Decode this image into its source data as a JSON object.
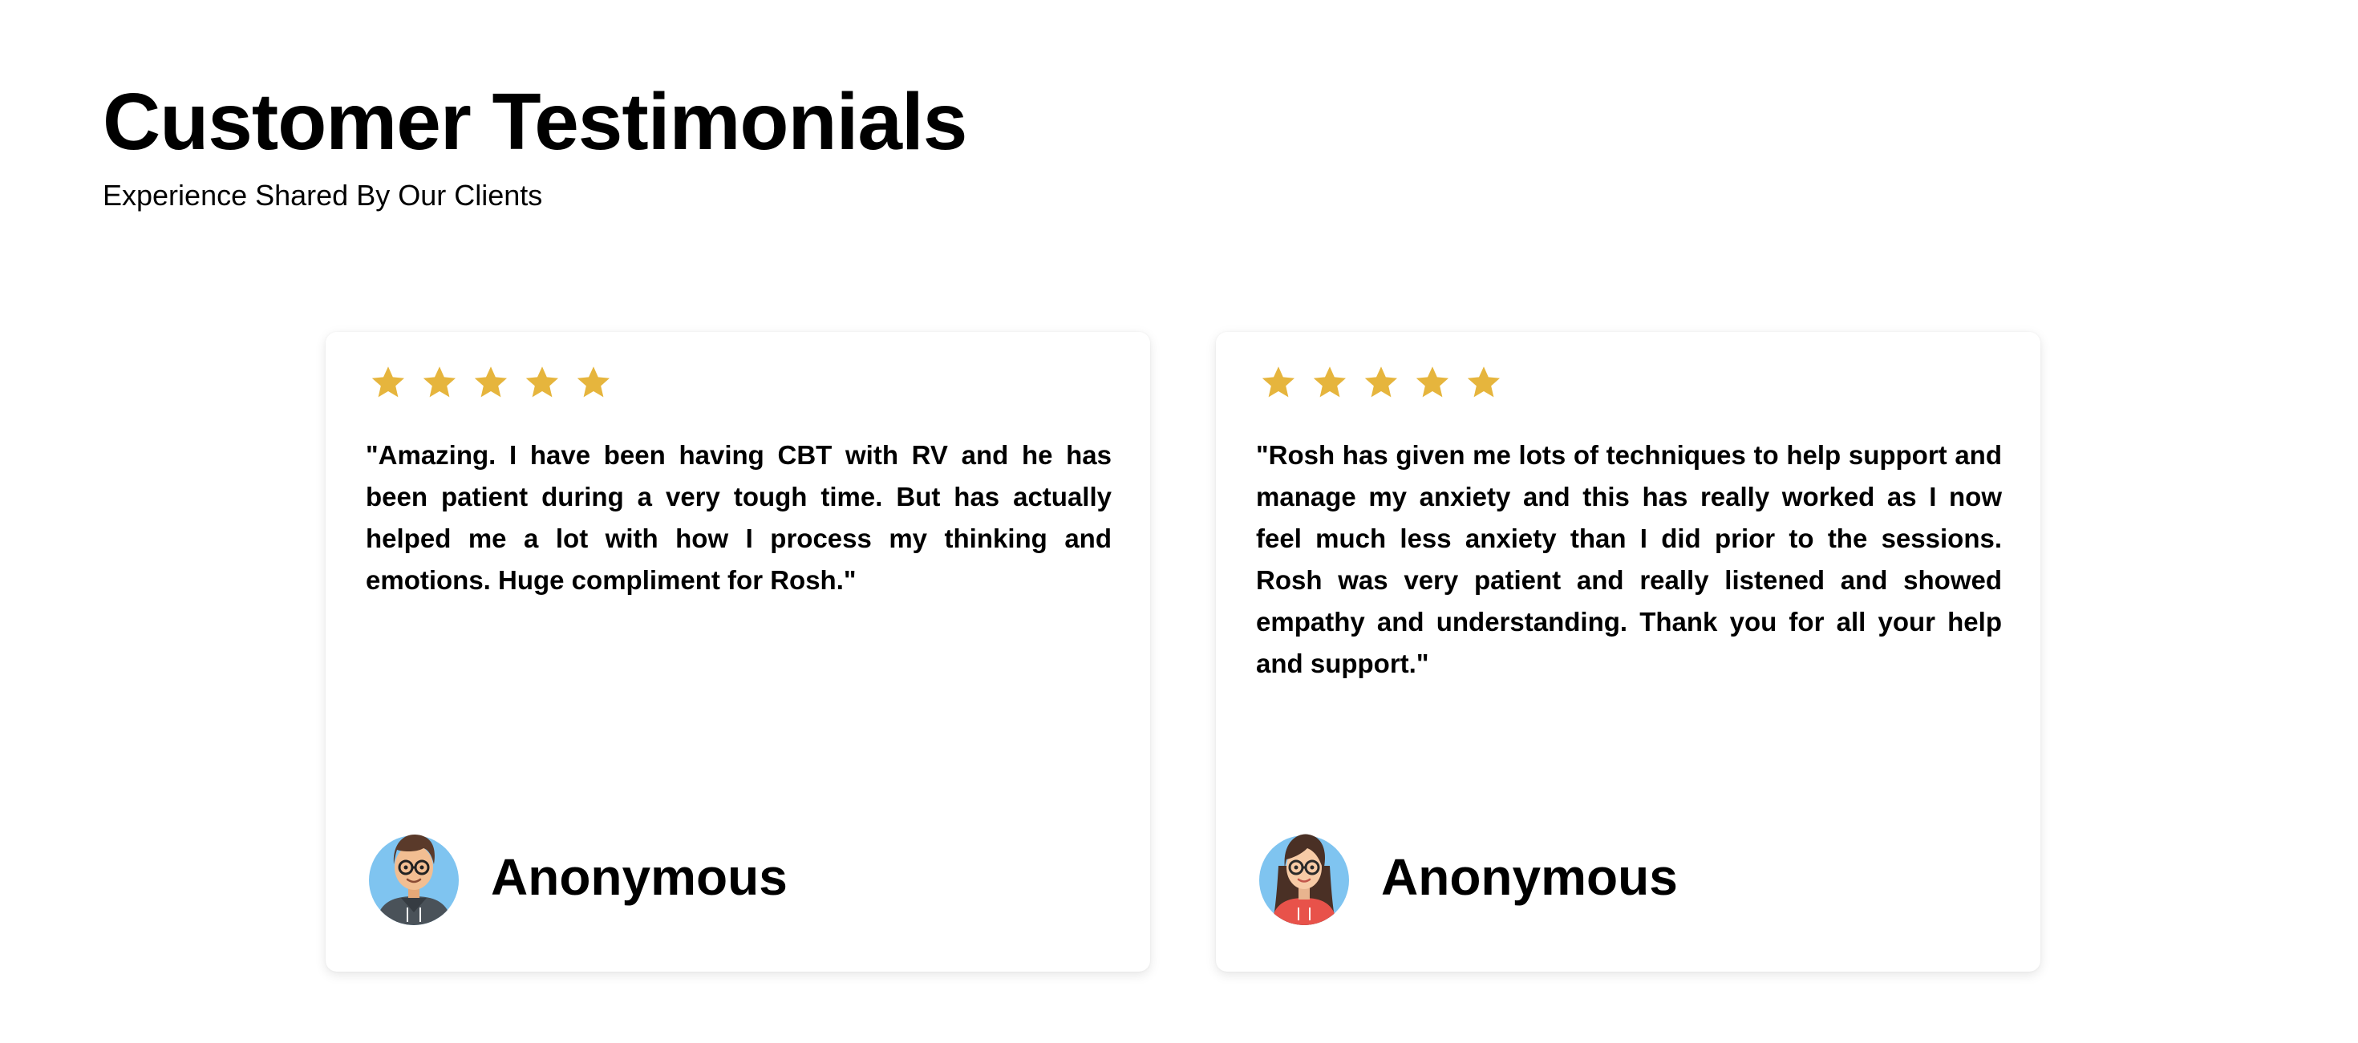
{
  "header": {
    "title": "Customer Testimonials",
    "subtitle": "Experience Shared By Our Clients"
  },
  "colors": {
    "star": "#E6B53D",
    "avatar_background": "#7FC4F0"
  },
  "testimonials": [
    {
      "rating": 5,
      "quote": "\"Amazing. I have been having CBT with RV and he has been patient during a very tough time. But has actually helped me a lot with how I process my thinking and emotions. Huge compliment for Rosh.\"",
      "author": "Anonymous",
      "avatar": "male-avatar-with-glasses"
    },
    {
      "rating": 5,
      "quote": "\"Rosh has given me lots of techniques to help support and manage my anxiety and this has really worked as I now feel much less anxiety than I did prior to the sessions. Rosh was very patient and really listened and showed empathy and understanding. Thank you for all your help and support.\"",
      "author": "Anonymous",
      "avatar": "female-avatar-with-glasses"
    }
  ]
}
